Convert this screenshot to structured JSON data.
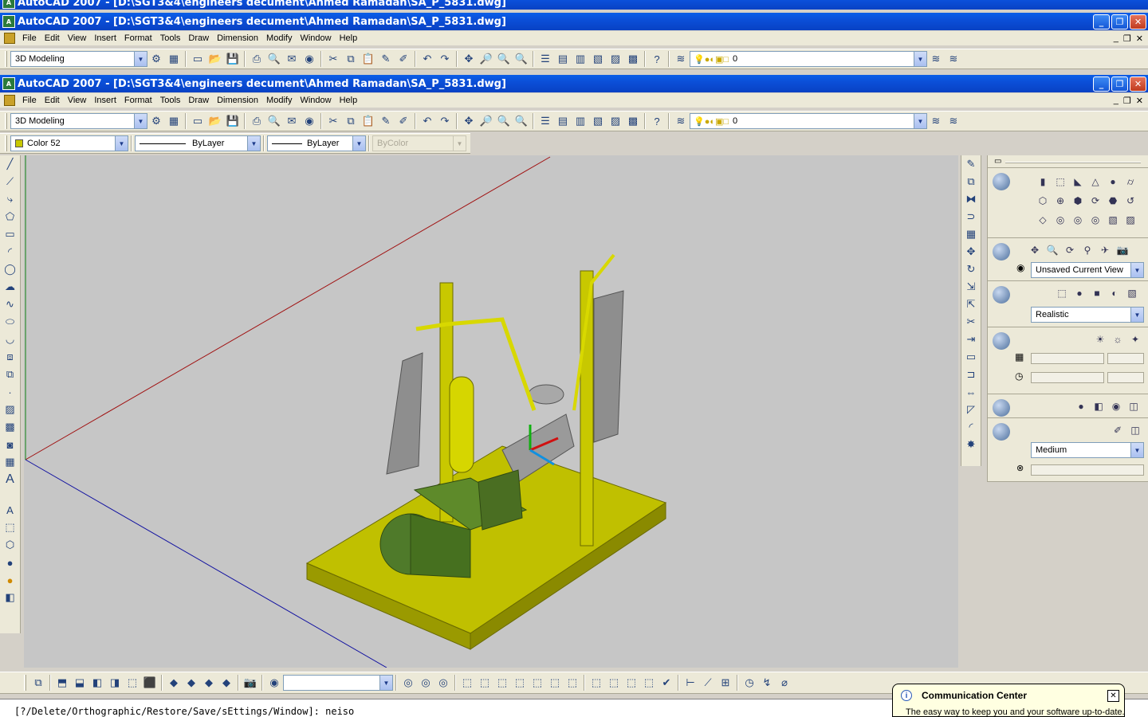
{
  "window_back": {
    "title": "AutoCAD 2007 - [D:\\SGT3&4\\engineers decument\\Ahmed Ramadan\\SA_P_5831.dwg]"
  },
  "window_front": {
    "title": "AutoCAD 2007 - [D:\\SGT3&4\\engineers decument\\Ahmed Ramadan\\SA_P_5831.dwg]"
  },
  "window_controls": {
    "minimize": "_",
    "restore": "❐",
    "close": "✕"
  },
  "menu": [
    "File",
    "Edit",
    "View",
    "Insert",
    "Format",
    "Tools",
    "Draw",
    "Dimension",
    "Modify",
    "Window",
    "Help"
  ],
  "workspace": {
    "value": "3D Modeling"
  },
  "layer": {
    "value": "0"
  },
  "properties": {
    "color": "Color 52",
    "linetype": "ByLayer",
    "lineweight": "ByLayer",
    "plotstyle": "ByColor"
  },
  "view_panel": {
    "named_view": "Unsaved Current View"
  },
  "visual_style_panel": {
    "style": "Realistic"
  },
  "render_panel": {
    "quality": "Medium"
  },
  "command_line": {
    "text": "[?/Delete/Orthographic/Restore/Save/sEttings/Window]:  neiso"
  },
  "communication_center": {
    "title": "Communication Center",
    "body": "The easy way to keep you and your software up-to-date."
  },
  "colors": {
    "titlebar": "#0a5ee8",
    "viewport": "#c6c6c6",
    "model": "#c8c800",
    "motor": "#4f7a2a"
  }
}
